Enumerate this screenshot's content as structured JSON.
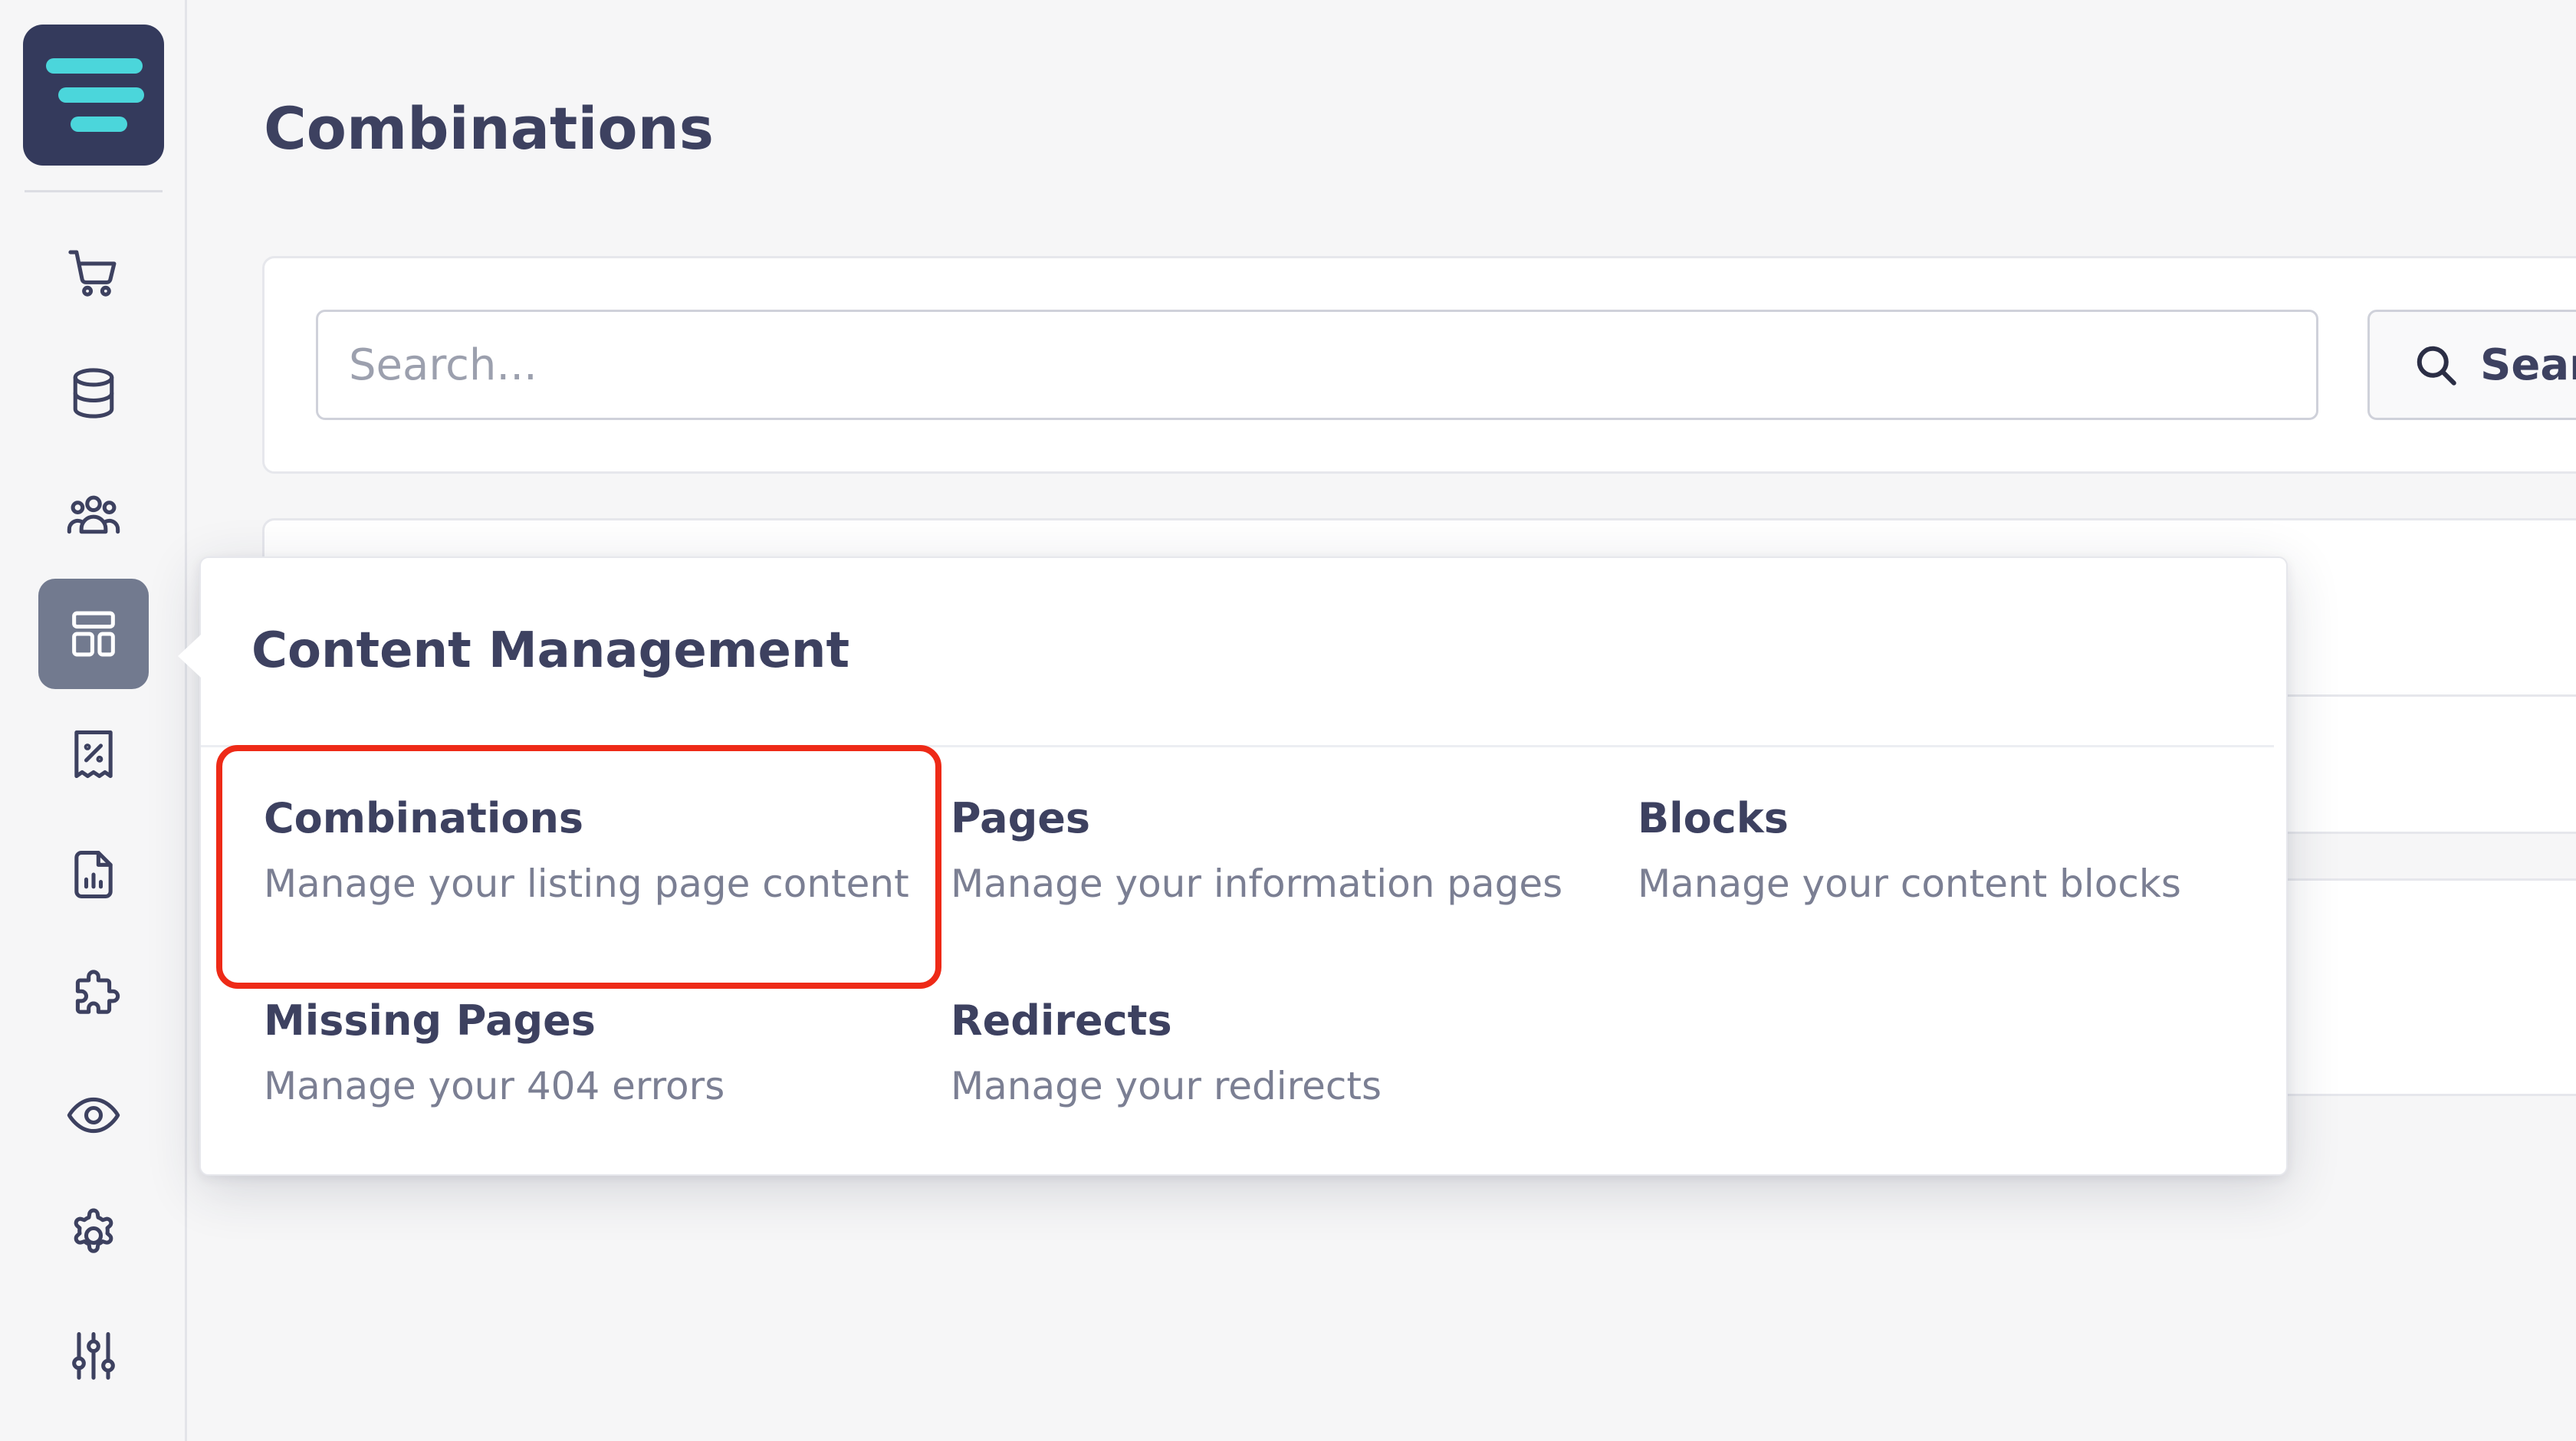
{
  "page": {
    "title": "Combinations"
  },
  "search": {
    "placeholder": "Search...",
    "value": "",
    "button_label": "Search"
  },
  "sidebar": {
    "items": [
      {
        "name": "orders",
        "icon": "cart-icon",
        "active": false
      },
      {
        "name": "database",
        "icon": "database-icon",
        "active": false
      },
      {
        "name": "customers",
        "icon": "users-icon",
        "active": false
      },
      {
        "name": "content",
        "icon": "layout-icon",
        "active": true
      },
      {
        "name": "discounts",
        "icon": "receipt-percent-icon",
        "active": false
      },
      {
        "name": "reports",
        "icon": "report-chart-icon",
        "active": false
      },
      {
        "name": "extensions",
        "icon": "puzzle-icon",
        "active": false
      },
      {
        "name": "preview",
        "icon": "eye-icon",
        "active": false
      },
      {
        "name": "settings",
        "icon": "gear-icon",
        "active": false
      },
      {
        "name": "adjustments",
        "icon": "sliders-icon",
        "active": false
      }
    ]
  },
  "menu": {
    "title": "Content Management",
    "items": [
      {
        "label": "Combinations",
        "description": "Manage your listing page content",
        "highlighted": true
      },
      {
        "label": "Pages",
        "description": "Manage your information pages",
        "highlighted": false
      },
      {
        "label": "Blocks",
        "description": "Manage your content blocks",
        "highlighted": false
      },
      {
        "label": "Missing Pages",
        "description": "Manage your 404 errors",
        "highlighted": false
      },
      {
        "label": "Redirects",
        "description": "Manage your redirects",
        "highlighted": false
      }
    ]
  },
  "colors": {
    "brand_dark": "#343a5c",
    "brand_accent": "#4bd6db",
    "text": "#3d4160",
    "muted_text": "#7b7f93",
    "active_nav": "#727a8f",
    "highlight": "#ee2a17"
  }
}
